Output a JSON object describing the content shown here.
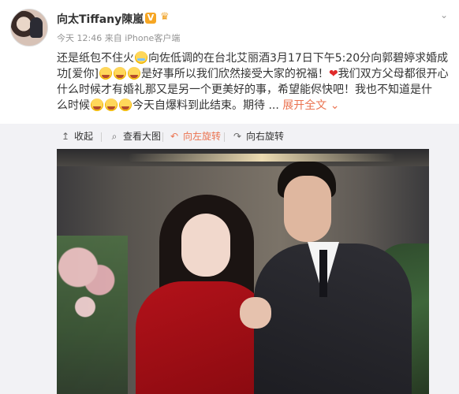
{
  "header": {
    "username": "向太Tiffany陳嵐",
    "verified_badge": "V",
    "meta_time": "今天 12:46",
    "meta_source": "来自 iPhone客户端",
    "avatar_icon": "avatar-icon",
    "more_icon": "chevron-down-icon"
  },
  "post": {
    "line1_a": "还是纸包不住火",
    "line1_b": "向佐低调的在台北艾丽酒3月17日下午5:20分向郭碧婷求婚成",
    "line2_a": "功[爱你]",
    "line2_b": "是好事所以我们欣然接受大家的祝福！",
    "line2_c": "我们双方父母都很开心",
    "line3": "什么时候才有婚礼那又是另一个更美好的事，希望能侭快吧！我也不知道是什",
    "line4_a": "么时候",
    "line4_b": "今天自爆料到此结束。期待 ...",
    "expand": "展开全文",
    "expand_icon": "chevron-down-icon"
  },
  "actions": [
    {
      "label": "收起",
      "icon": "collapse-icon"
    },
    {
      "label": "查看大图",
      "icon": "search-icon"
    },
    {
      "label": "向左旋转",
      "icon": "rotate-left-icon"
    },
    {
      "label": "向右旋转",
      "icon": "rotate-right-icon"
    }
  ],
  "colors": {
    "accent": "#eb7350",
    "text": "#333333",
    "meta": "#939393",
    "toolbar_bg": "#f2f2f5"
  }
}
